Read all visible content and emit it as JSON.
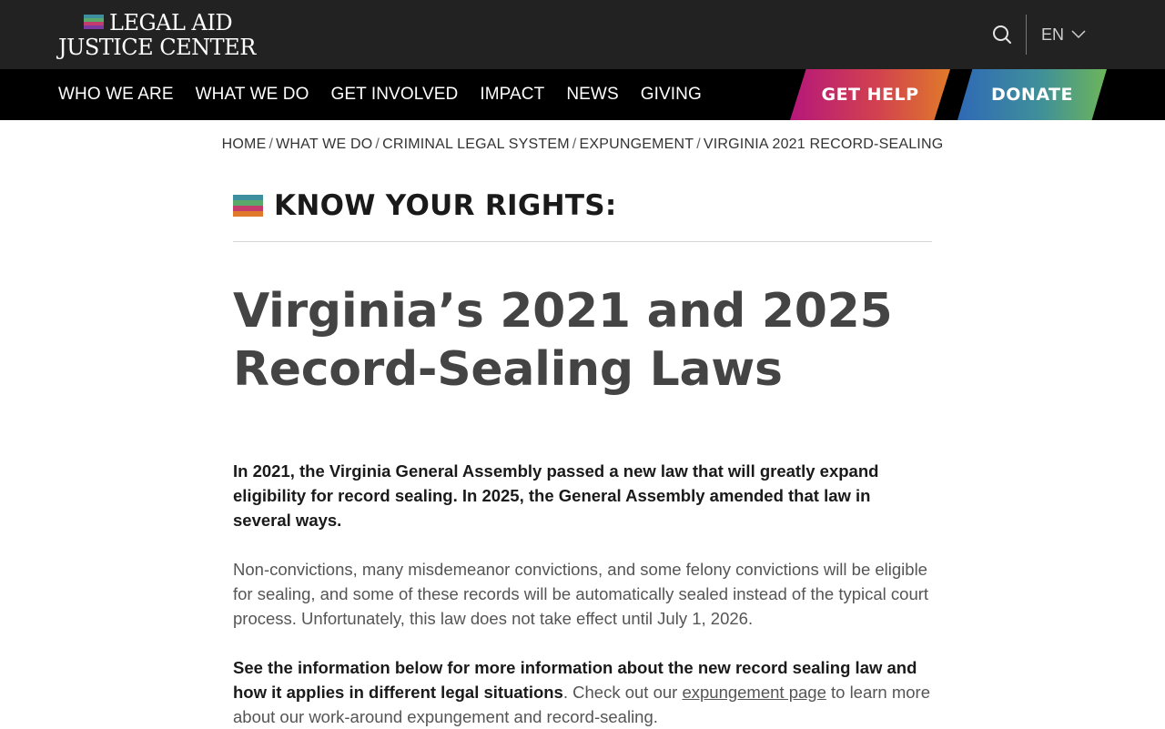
{
  "header": {
    "logo_line1": "LEGAL AID",
    "logo_line2": "JUSTICE CENTER",
    "search_icon": "search-icon",
    "language": "EN",
    "language_icon": "chevron-down-icon"
  },
  "nav": {
    "items": [
      "WHO WE ARE",
      "WHAT WE DO",
      "GET INVOLVED",
      "IMPACT",
      "NEWS",
      "GIVING"
    ],
    "get_help": "GET HELP",
    "donate": "DONATE"
  },
  "breadcrumb": {
    "items": [
      "HOME",
      "WHAT WE DO",
      "CRIMINAL LEGAL SYSTEM",
      "EXPUNGEMENT",
      "VIRGINIA 2021 RECORD-SEALING"
    ],
    "separator": "/"
  },
  "main": {
    "kicker": "KNOW YOUR RIGHTS:",
    "title": "Virginia’s 2021 and 2025 Record-Sealing Laws",
    "lead": "In 2021, the Virginia General Assembly passed a new law that will greatly expand eligibility for record sealing. In 2025, the General Assembly amended that law in several ways.",
    "para2": "Non-convictions, many misdemeanor convictions, and some felony convictions will be eligible for sealing, and some of these records will be automatically sealed instead of the typical court process. Unfortunately, this law does not take effect until July 1, 2026.",
    "para3_bold": "See the information below for more information about the new record sealing law and how it applies in different legal situations",
    "para3_mid": ". Check out our",
    "para3_link": "expungement page",
    "para3_end": " to learn more about our work-around expungement and record-sealing."
  },
  "colors": {
    "header_bg": "#222222",
    "nav_bg": "#000000",
    "get_help_gradient": [
      "#b5177a",
      "#d2424e",
      "#e07a2a"
    ],
    "donate_gradient": [
      "#2f69b6",
      "#3f8f9a",
      "#6db55a"
    ],
    "title_color": "#444444"
  }
}
